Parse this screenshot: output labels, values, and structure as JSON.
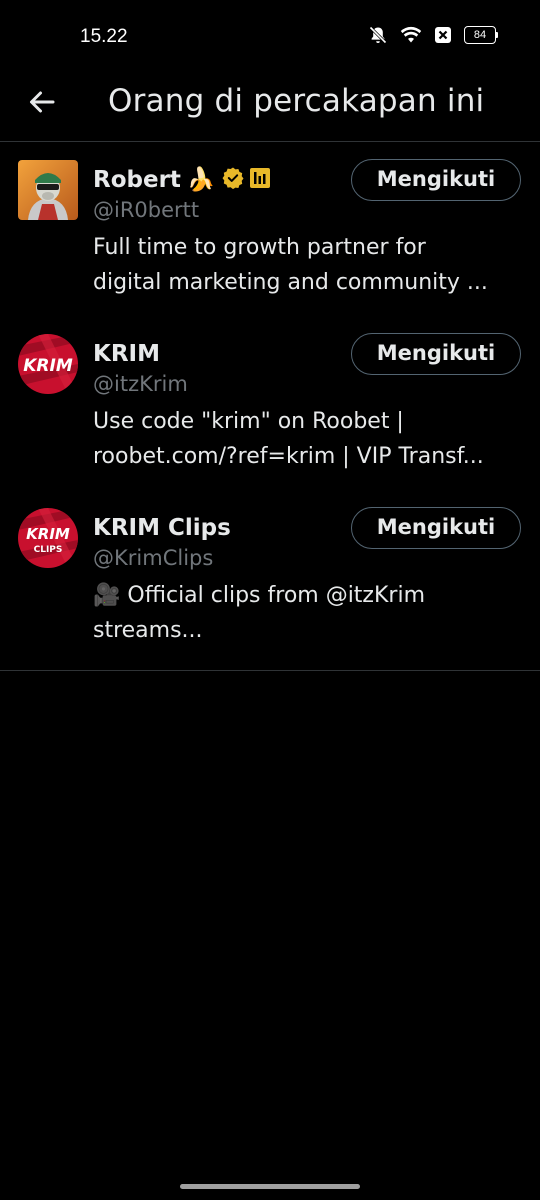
{
  "status_bar": {
    "time": "15.22",
    "battery": "84",
    "icons": [
      "bell-muted-icon",
      "wifi-icon",
      "sim-off-icon",
      "battery-icon"
    ]
  },
  "header": {
    "back_icon": "arrow-left-icon",
    "title": "Orang di percakapan ini"
  },
  "users": [
    {
      "display_name": "Robert",
      "name_emoji": "🍌",
      "badges": [
        "gold-verified-badge-icon",
        "affiliate-badge-icon"
      ],
      "handle": "@iR0bertt",
      "bio": "Full time to growth partner for\ndigital marketing and community ...",
      "follow_label": "Mengikuti"
    },
    {
      "display_name": "KRIM",
      "handle": "@itzKrim",
      "bio": "Use code \"krim\" on Roobet |\nroobet.com/?ref=krim | VIP Transf...",
      "follow_label": "Mengikuti",
      "avatar_text": "KRIM"
    },
    {
      "display_name": "KRIM Clips",
      "handle": "@KrimClips",
      "bio": "🎥 Official clips from @itzKrim\nstreams...",
      "follow_label": "Mengikuti",
      "avatar_text": "KRIM",
      "avatar_subtext": "CLIPS"
    }
  ],
  "colors": {
    "background": "#000000",
    "text": "#e7e9ea",
    "secondary_text": "#71767b",
    "divider": "#2f3336",
    "button_border": "#536471",
    "gold_badge": "#e8b829",
    "krim_red": "#c8102e"
  }
}
